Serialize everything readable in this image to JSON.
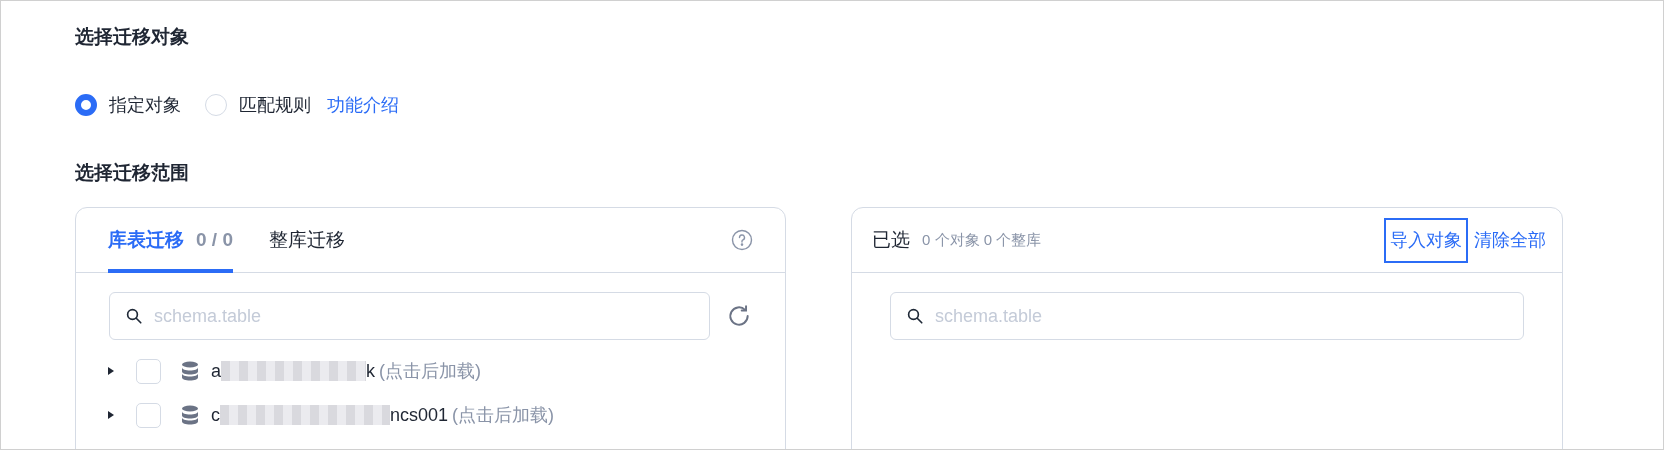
{
  "sections": [
    {
      "title": "选择迁移对象"
    },
    {
      "title": "选择迁移范围"
    }
  ],
  "mode_options": [
    {
      "label": "指定对象",
      "selected": true
    },
    {
      "label": "匹配规则",
      "selected": false
    }
  ],
  "help_link": "功能介绍",
  "left_panel": {
    "tabs": [
      {
        "label": "库表迁移",
        "count": "0 / 0",
        "selected": true
      },
      {
        "label": "整库迁移",
        "selected": false
      }
    ],
    "search": {
      "placeholder": "schema.table"
    },
    "tree": [
      {
        "name_start": "a",
        "name_end": "k",
        "hint": "(点击后加载)",
        "checked": false,
        "expanded": false
      },
      {
        "name_start": "c",
        "name_end": "ncs001",
        "hint": "(点击后加载)",
        "checked": false,
        "expanded": false
      }
    ]
  },
  "right_panel": {
    "title": "已选",
    "summary": "0 个对象 0 个整库",
    "actions": [
      {
        "label": "导入对象",
        "focused": true
      },
      {
        "label": "清除全部",
        "focused": false
      }
    ],
    "search": {
      "placeholder": "schema.table"
    }
  }
}
